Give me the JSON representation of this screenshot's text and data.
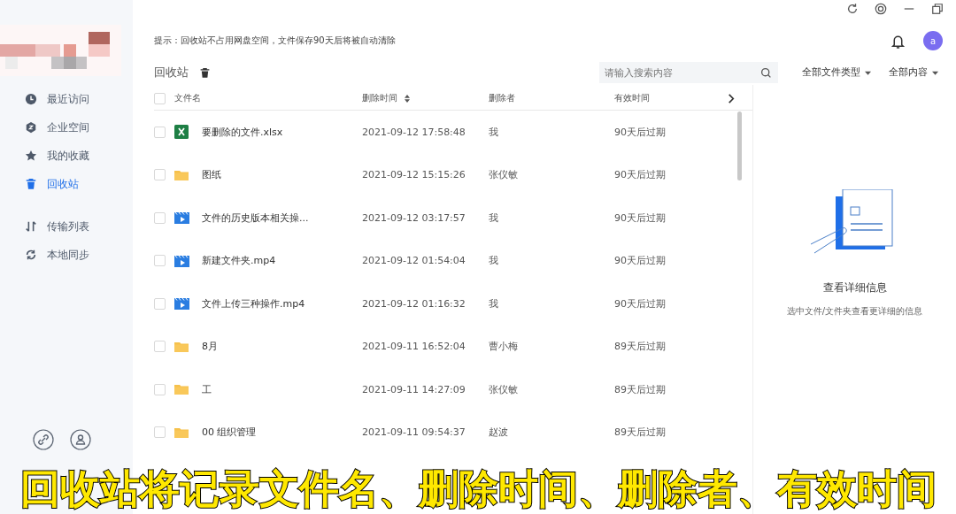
{
  "sidebar": {
    "sections": [
      {
        "items": [
          {
            "label": "最近访问",
            "selected": false
          },
          {
            "label": "企业空间",
            "selected": false
          },
          {
            "label": "我的收藏",
            "selected": false
          },
          {
            "label": "回收站",
            "selected": true
          }
        ]
      },
      {
        "items": [
          {
            "label": "传输列表",
            "selected": false
          },
          {
            "label": "本地同步",
            "selected": false
          }
        ]
      }
    ]
  },
  "header": {
    "tip": "提示：回收站不占用网盘空间，文件保存90天后将被自动清除",
    "avatar": "a"
  },
  "toolbar": {
    "title": "回收站",
    "search": {
      "placeholder": "请输入搜索内容"
    },
    "filters": [
      "全部文件类型",
      "全部内容"
    ]
  },
  "table": {
    "header_checked": false,
    "columns": [
      {
        "label": "文件名",
        "sortable": false
      },
      {
        "label": "删除时间",
        "sortable": true
      },
      {
        "label": "删除者",
        "sortable": false
      },
      {
        "label": "有效时间",
        "sortable": false
      }
    ],
    "rows": [
      {
        "kind": "excel",
        "name": "要删除的文件.xlsx",
        "time": "2021-09-12 17:58:48",
        "by": "我",
        "valid": "90天后过期",
        "checked": false
      },
      {
        "kind": "folder",
        "name": "图纸",
        "time": "2021-09-12 15:15:26",
        "by": "张仪敏",
        "valid": "90天后过期",
        "checked": false
      },
      {
        "kind": "video",
        "name": "文件的历史版本相关操...",
        "time": "2021-09-12 03:17:57",
        "by": "我",
        "valid": "90天后过期",
        "checked": false
      },
      {
        "kind": "video",
        "name": "新建文件夹.mp4",
        "time": "2021-09-12 01:54:04",
        "by": "我",
        "valid": "90天后过期",
        "checked": false
      },
      {
        "kind": "video",
        "name": "文件上传三种操作.mp4",
        "time": "2021-09-12 01:16:32",
        "by": "我",
        "valid": "90天后过期",
        "checked": false
      },
      {
        "kind": "folder",
        "name": "8月",
        "time": "2021-09-11 16:52:04",
        "by": "曹小梅",
        "valid": "89天后过期",
        "checked": false
      },
      {
        "kind": "folder",
        "name": "工",
        "time": "2021-09-11 14:27:09",
        "by": "张仪敏",
        "valid": "89天后过期",
        "checked": false
      },
      {
        "kind": "folder",
        "name": "00 组织管理",
        "time": "2021-09-11 09:54:37",
        "by": "赵波",
        "valid": "89天后过期",
        "checked": false
      }
    ]
  },
  "detail": {
    "title": "查看详细信息",
    "hint": "选中文件/文件夹查看更详细的信息"
  },
  "caption": "回收站将记录文件名、删除时间、删除者、有效时间"
}
